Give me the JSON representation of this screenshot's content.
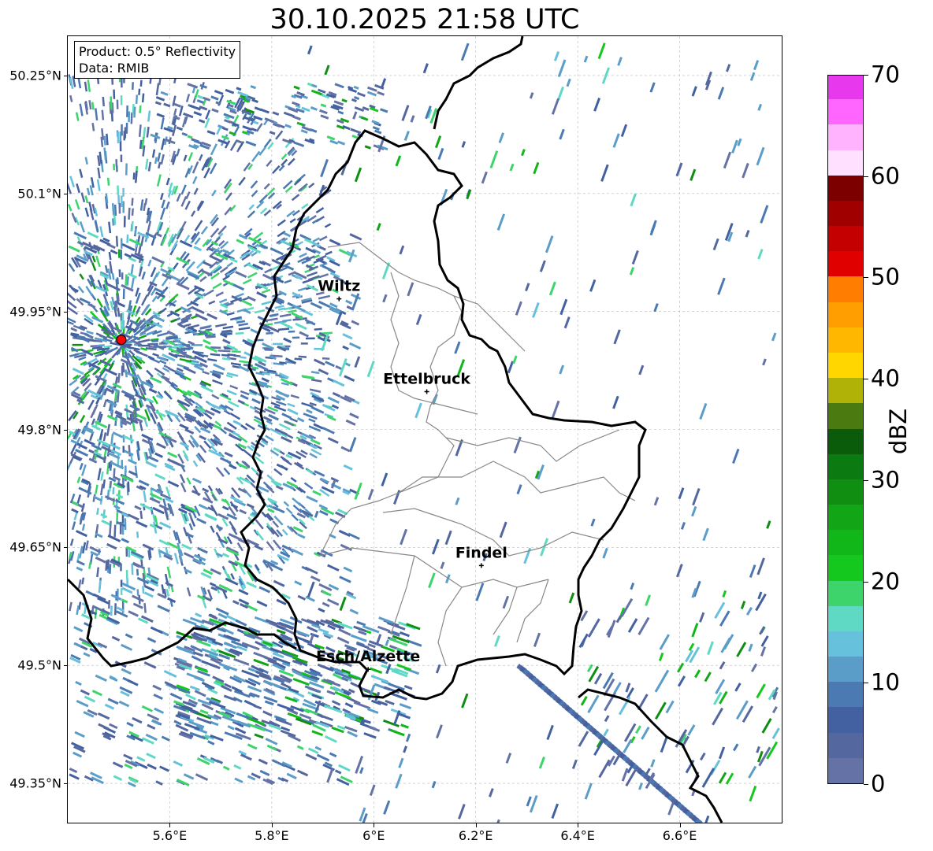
{
  "title": "30.10.2025 21:58 UTC",
  "info": {
    "product": "Product: 0.5° Reflectivity",
    "data": "Data: RMIB"
  },
  "lat_ticks": [
    {
      "label": "50.25°N",
      "value": 50.25
    },
    {
      "label": "50.1°N",
      "value": 50.1
    },
    {
      "label": "49.95°N",
      "value": 49.95
    },
    {
      "label": "49.8°N",
      "value": 49.8
    },
    {
      "label": "49.65°N",
      "value": 49.65
    },
    {
      "label": "49.5°N",
      "value": 49.5
    },
    {
      "label": "49.35°N",
      "value": 49.35
    }
  ],
  "lon_ticks": [
    {
      "label": "5.6°E",
      "value": 5.6
    },
    {
      "label": "5.8°E",
      "value": 5.8
    },
    {
      "label": "6°E",
      "value": 6.0
    },
    {
      "label": "6.2°E",
      "value": 6.2
    },
    {
      "label": "6.4°E",
      "value": 6.4
    },
    {
      "label": "6.6°E",
      "value": 6.6
    }
  ],
  "extent": {
    "lon_min": 5.4,
    "lon_max": 6.8,
    "lat_min": 49.3,
    "lat_max": 50.3
  },
  "radar_site": {
    "lon": 5.505,
    "lat": 49.914
  },
  "cities": [
    {
      "name": "Wiltz",
      "lon": 5.932,
      "lat": 49.966
    },
    {
      "name": "Ettelbruck",
      "lon": 6.104,
      "lat": 49.848
    },
    {
      "name": "Findel",
      "lon": 6.211,
      "lat": 49.627
    },
    {
      "name": "Esch/Alzette",
      "lon": 5.989,
      "lat": 49.495
    }
  ],
  "colorbar": {
    "unit": "dBZ",
    "ticks": [
      "0",
      "10",
      "20",
      "30",
      "40",
      "50",
      "60",
      "70"
    ],
    "min": 0,
    "max": 70,
    "step": 2.5,
    "colors": [
      "#6472a6",
      "#55679f",
      "#4360a0",
      "#4b79b2",
      "#5b9dc9",
      "#66c1dc",
      "#5fd9c4",
      "#3dd46c",
      "#14c81e",
      "#11b618",
      "#12a516",
      "#0f8e12",
      "#0b7a10",
      "#0a5c0b",
      "#4a7a10",
      "#b0b208",
      "#ffd600",
      "#ffb700",
      "#ff9e00",
      "#ff7d00",
      "#e00000",
      "#c40000",
      "#a00000",
      "#7c0000",
      "#ffe0ff",
      "#ffb3ff",
      "#ff66ff",
      "#e838ee"
    ]
  },
  "colors": {
    "border": "#000000",
    "canton_lines": "#888888",
    "grid": "#bbbbbb",
    "radar_marker": "#ff0000"
  }
}
